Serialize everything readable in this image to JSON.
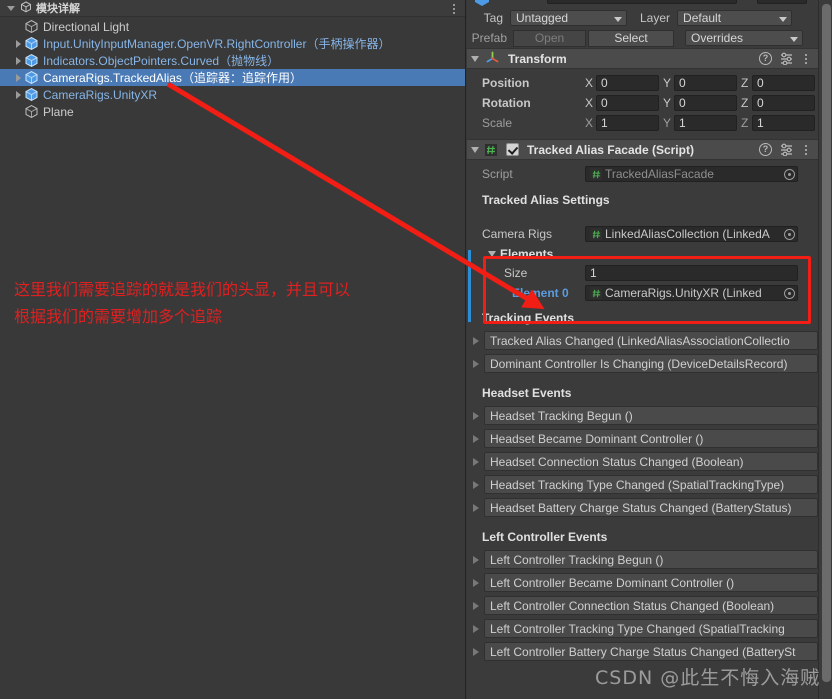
{
  "hierarchy": {
    "tab_label": "模块详解",
    "tab_icon": "hierarchy-icon",
    "menu_icon": "kebab-menu-icon",
    "items": [
      {
        "label": "Directional Light",
        "note": "",
        "expandable": false,
        "prefab": false,
        "selected": false,
        "indent": 1
      },
      {
        "label": "Input.UnityInputManager.OpenVR.RightController",
        "note": "（手柄操作器）",
        "expandable": true,
        "prefab": true,
        "selected": false,
        "indent": 1
      },
      {
        "label": "Indicators.ObjectPointers.Curved",
        "note": "（抛物线）",
        "expandable": true,
        "prefab": true,
        "selected": false,
        "indent": 1
      },
      {
        "label": "CameraRigs.TrackedAlias",
        "note": "（追踪器：追踪作用）",
        "expandable": true,
        "prefab": true,
        "selected": true,
        "indent": 1
      },
      {
        "label": "CameraRigs.UnityXR",
        "note": "",
        "expandable": true,
        "prefab": true,
        "selected": false,
        "indent": 1
      },
      {
        "label": "Plane",
        "note": "",
        "expandable": false,
        "prefab": false,
        "selected": false,
        "indent": 1
      }
    ]
  },
  "annotation": {
    "text": "这里我们需要追踪的就是我们的头显，并且可以\n根据我们的需要增加多个追踪",
    "color": "#e02020"
  },
  "inspector": {
    "tag": {
      "label": "Tag",
      "value": "Untagged"
    },
    "layer": {
      "label": "Layer",
      "value": "Default"
    },
    "prefab": {
      "label": "Prefab",
      "open_label": "Open",
      "select_label": "Select",
      "overrides_label": "Overrides"
    },
    "transform": {
      "title": "Transform",
      "icon": "transform-axis-icon",
      "rows": [
        {
          "label": "Position",
          "dim": false,
          "axes": [
            {
              "letter": "X",
              "value": "0"
            },
            {
              "letter": "Y",
              "value": "0"
            },
            {
              "letter": "Z",
              "value": "0"
            }
          ]
        },
        {
          "label": "Rotation",
          "dim": false,
          "axes": [
            {
              "letter": "X",
              "value": "0"
            },
            {
              "letter": "Y",
              "value": "0"
            },
            {
              "letter": "Z",
              "value": "0"
            }
          ]
        },
        {
          "label": "Scale",
          "dim": true,
          "axes": [
            {
              "letter": "X",
              "value": "1"
            },
            {
              "letter": "Y",
              "value": "1"
            },
            {
              "letter": "Z",
              "value": "1"
            }
          ]
        }
      ]
    },
    "tracked_alias": {
      "title": "Tracked Alias Facade (Script)",
      "enabled": true,
      "icon": "script-hash-icon",
      "script_label": "Script",
      "script_value": "TrackedAliasFacade",
      "settings_header": "Tracked Alias Settings",
      "camera_rigs_label": "Camera Rigs",
      "camera_rigs_value": "LinkedAliasCollection (LinkedA",
      "elements_label": "Elements",
      "size_label": "Size",
      "size_value": "1",
      "element0_label": "Element 0",
      "element0_value": "CameraRigs.UnityXR (Linked",
      "tracking_events_header": "Tracking Events",
      "tracking_events": [
        "Tracked Alias Changed (LinkedAliasAssociationCollectio",
        "Dominant Controller Is Changing (DeviceDetailsRecord)"
      ],
      "headset_events_header": "Headset Events",
      "headset_events": [
        "Headset Tracking Begun ()",
        "Headset Became Dominant Controller ()",
        "Headset Connection Status Changed (Boolean)",
        "Headset Tracking Type Changed (SpatialTrackingType)",
        "Headset Battery Charge Status Changed (BatteryStatus)"
      ],
      "left_controller_events_header": "Left Controller Events",
      "left_controller_events": [
        "Left Controller Tracking Begun ()",
        "Left Controller Became Dominant Controller ()",
        "Left Controller Connection Status Changed (Boolean)",
        "Left Controller Tracking Type Changed (SpatialTracking",
        "Left Controller Battery Charge Status Changed (BatterySt"
      ]
    }
  },
  "watermark": {
    "text": "CSDN @此生不悔入海贼"
  },
  "colors": {
    "selection_blue": "#4a7ab5",
    "prefab_blue": "#86b5e8",
    "annotation_red": "#e02020",
    "highlight_red": "#f01e14",
    "panel_bg": "#393939",
    "inspector_bg": "#3b3b3b"
  }
}
